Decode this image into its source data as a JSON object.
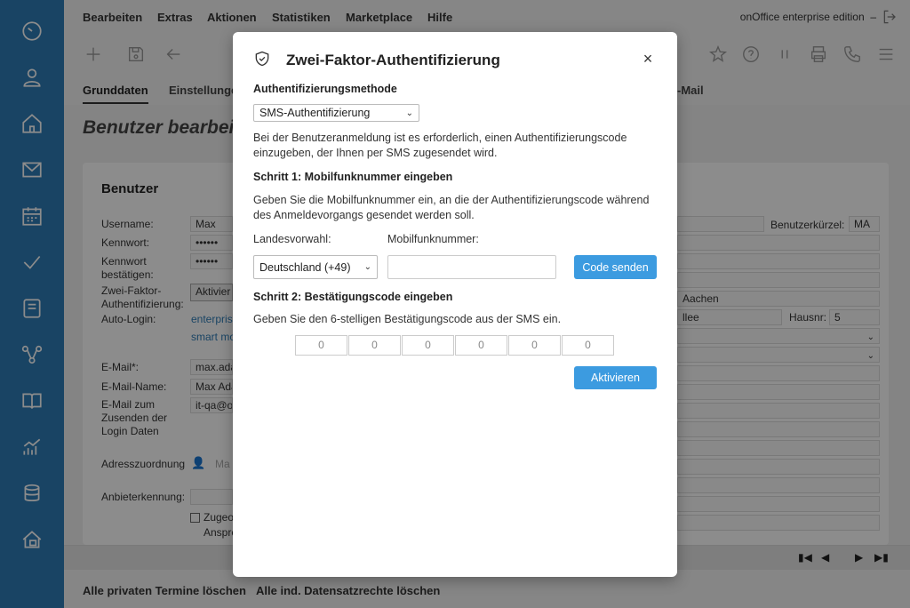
{
  "menu": {
    "items": [
      "Bearbeiten",
      "Extras",
      "Aktionen",
      "Statistiken",
      "Marketplace",
      "Hilfe"
    ],
    "edition": "onOffice enterprise edition",
    "edition_dash": "–"
  },
  "tabs": [
    "Grunddaten",
    "Einstellungen",
    "-Mail"
  ],
  "page": {
    "title": "Benutzer bearbeit"
  },
  "card": {
    "title": "Benutzer",
    "labels": {
      "username": "Username:",
      "password": "Kennwort:",
      "password_confirm": "Kennwort bestätigen:",
      "twofa": "Zwei-Faktor-Authentifizierung:",
      "autologin": "Auto-Login:",
      "email": "E-Mail*:",
      "email_name": "E-Mail-Name:",
      "email_send": "E-Mail zum Zusenden der Login Daten",
      "address": "Adresszuordnung",
      "provider": "Anbieterkennung:",
      "short": "Benutzerkürzel:",
      "houseno": "Hausnr:"
    },
    "values": {
      "username": "Max",
      "password": "••••••",
      "password_confirm": "••••••",
      "twofa_btn": "Aktivier",
      "autologin_link1": "enterpris",
      "autologin_link2": "smart mo",
      "email": "max.ada",
      "email_name": "Max Ada",
      "email_send": "it-qa@o",
      "address": "Ma",
      "short": "MA",
      "city": "Aachen",
      "street": "llee",
      "houseno": "5",
      "checkbox1": "Zugeo",
      "checkbox2": "Anspre"
    }
  },
  "bottom": {
    "btn1": "Alle privaten Termine löschen",
    "btn2": "Alle ind. Datensatzrechte löschen"
  },
  "modal": {
    "title": "Zwei-Faktor-Authentifizierung",
    "method_label": "Authentifizierungsmethode",
    "method_value": "SMS-Authentifizierung",
    "description": "Bei der Benutzeranmeldung ist es erforderlich, einen Authentifizierungscode einzugeben, der Ihnen per SMS zugesendet wird.",
    "step1_title": "Schritt 1: Mobilfunknummer eingeben",
    "step1_text": "Geben Sie die Mobilfunknummer ein, an die der Authentifizierungscode während des Anmeldevorgangs gesendet werden soll.",
    "country_label": "Landesvorwahl:",
    "country_value": "Deutschland (+49)",
    "mobile_label": "Mobilfunknummer:",
    "mobile_value": "",
    "send_code_btn": "Code senden",
    "step2_title": "Schritt 2: Bestätigungscode eingeben",
    "step2_text": "Geben Sie den 6-stelligen Bestätigungscode aus der SMS ein.",
    "code_placeholders": [
      "0",
      "0",
      "0",
      "0",
      "0",
      "0"
    ],
    "activate_btn": "Aktivieren",
    "close": "×"
  },
  "colors": {
    "sidebar": "#2f7db7",
    "accent": "#3c9be0",
    "link": "#2f7db7"
  }
}
